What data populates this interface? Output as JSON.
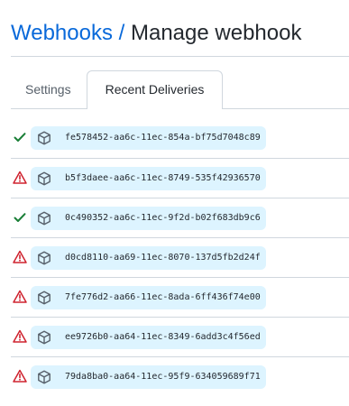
{
  "breadcrumb": {
    "parent": "Webhooks",
    "separator": "/",
    "current": "Manage webhook"
  },
  "tabs": [
    {
      "label": "Settings",
      "selected": false
    },
    {
      "label": "Recent Deliveries",
      "selected": true
    }
  ],
  "colors": {
    "link": "#0969da",
    "success": "#1a7f37",
    "failure": "#cf222e",
    "guid_background": "#ddf4ff"
  },
  "deliveries": [
    {
      "status": "success",
      "status_icon": "check-icon",
      "icon": "package-icon",
      "guid": "fe578452-aa6c-11ec-854a-bf75d7048c89"
    },
    {
      "status": "failure",
      "status_icon": "alert-icon",
      "icon": "package-icon",
      "guid": "b5f3daee-aa6c-11ec-8749-535f42936570"
    },
    {
      "status": "success",
      "status_icon": "check-icon",
      "icon": "package-icon",
      "guid": "0c490352-aa6c-11ec-9f2d-b02f683db9c6"
    },
    {
      "status": "failure",
      "status_icon": "alert-icon",
      "icon": "package-icon",
      "guid": "d0cd8110-aa69-11ec-8070-137d5fb2d24f"
    },
    {
      "status": "failure",
      "status_icon": "alert-icon",
      "icon": "package-icon",
      "guid": "7fe776d2-aa66-11ec-8ada-6ff436f74e00"
    },
    {
      "status": "failure",
      "status_icon": "alert-icon",
      "icon": "package-icon",
      "guid": "ee9726b0-aa64-11ec-8349-6add3c4f56ed"
    },
    {
      "status": "failure",
      "status_icon": "alert-icon",
      "icon": "package-icon",
      "guid": "79da8ba0-aa64-11ec-95f9-634059689f71"
    }
  ]
}
